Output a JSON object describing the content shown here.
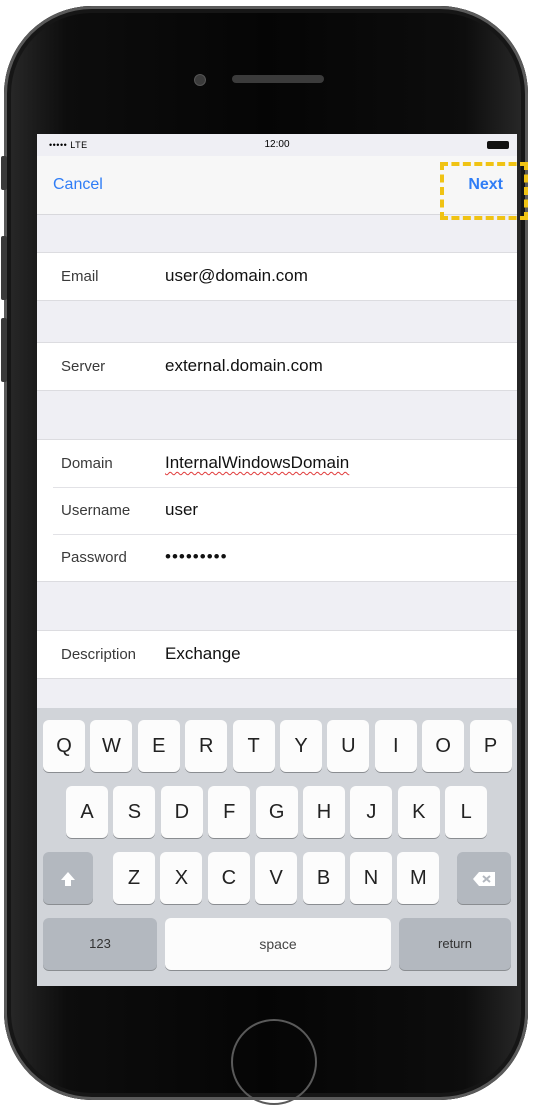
{
  "status_bar": {
    "signal": "••••• LTE",
    "time": "12:00"
  },
  "nav": {
    "cancel_label": "Cancel",
    "next_label": "Next"
  },
  "form": {
    "email": {
      "label": "Email",
      "value": "user@domain.com"
    },
    "server": {
      "label": "Server",
      "value": "external.domain.com"
    },
    "domain": {
      "label": "Domain",
      "value": "InternalWindowsDomain"
    },
    "username": {
      "label": "Username",
      "value": "user"
    },
    "password": {
      "label": "Password",
      "value": "•••••••••"
    },
    "description": {
      "label": "Description",
      "value": "Exchange"
    }
  },
  "keyboard": {
    "row1": [
      "Q",
      "W",
      "E",
      "R",
      "T",
      "Y",
      "U",
      "I",
      "O",
      "P"
    ],
    "row2": [
      "A",
      "S",
      "D",
      "F",
      "G",
      "H",
      "J",
      "K",
      "L"
    ],
    "row3": [
      "Z",
      "X",
      "C",
      "V",
      "B",
      "N",
      "M"
    ],
    "numbers_label": "123",
    "space_label": "space",
    "return_label": "return",
    "shift_icon": "shift-icon",
    "delete_icon": "delete-icon"
  },
  "colors": {
    "accent": "#2f7df6",
    "highlight": "#f0c314"
  }
}
